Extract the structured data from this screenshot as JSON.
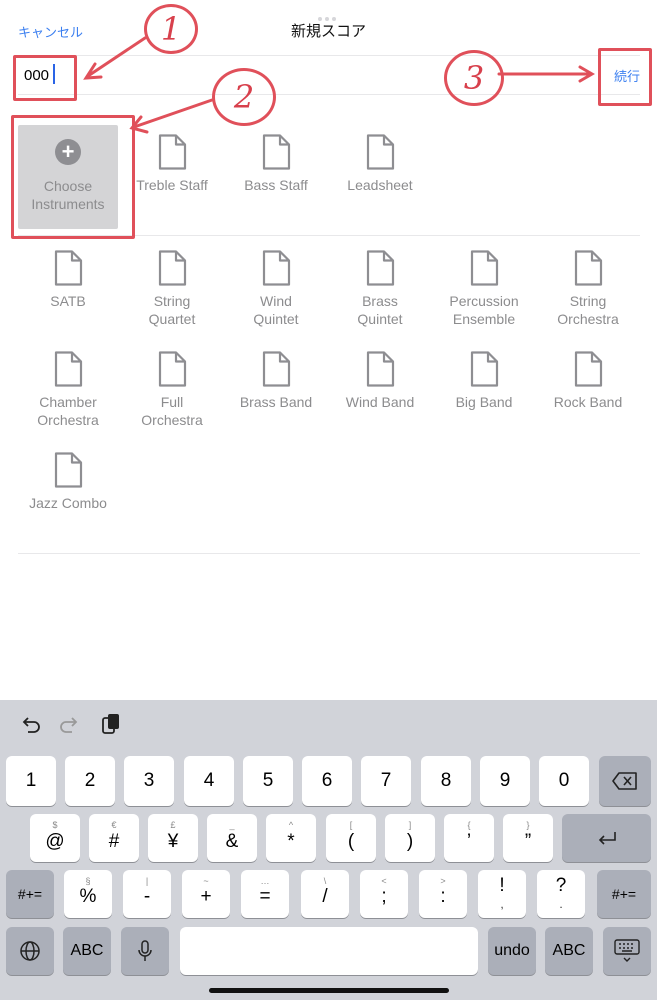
{
  "header": {
    "cancel_label": "キャンセル",
    "title": "新規スコア",
    "continue_label": "続行",
    "name_value": "000"
  },
  "annotations": [
    "1",
    "2",
    "3"
  ],
  "annotation_color": "#e0505a",
  "accent_color": "#3b7ff0",
  "choose": {
    "label_line1": "Choose",
    "label_line2": "Instruments",
    "icon": "plus-circle-icon"
  },
  "templates_row1": [
    {
      "l1": "Treble Staff",
      "l2": ""
    },
    {
      "l1": "Bass Staff",
      "l2": ""
    },
    {
      "l1": "Leadsheet",
      "l2": ""
    }
  ],
  "templates": [
    {
      "l1": "SATB",
      "l2": ""
    },
    {
      "l1": "String",
      "l2": "Quartet"
    },
    {
      "l1": "Wind",
      "l2": "Quintet"
    },
    {
      "l1": "Brass",
      "l2": "Quintet"
    },
    {
      "l1": "Percussion",
      "l2": "Ensemble"
    },
    {
      "l1": "String",
      "l2": "Orchestra"
    },
    {
      "l1": "Chamber",
      "l2": "Orchestra"
    },
    {
      "l1": "Full",
      "l2": "Orchestra"
    },
    {
      "l1": "Brass Band",
      "l2": ""
    },
    {
      "l1": "Wind Band",
      "l2": ""
    },
    {
      "l1": "Big Band",
      "l2": ""
    },
    {
      "l1": "Rock Band",
      "l2": ""
    },
    {
      "l1": "Jazz Combo",
      "l2": ""
    }
  ],
  "keyboard": {
    "toolbar": [
      "undo-icon",
      "redo-icon",
      "paste-icon"
    ],
    "row1": [
      "1",
      "2",
      "3",
      "4",
      "5",
      "6",
      "7",
      "8",
      "9",
      "0"
    ],
    "row2": [
      {
        "s": "$",
        "b": "@"
      },
      {
        "s": "€",
        "b": "#"
      },
      {
        "s": "£",
        "b": "¥"
      },
      {
        "s": "_",
        "b": "&"
      },
      {
        "s": "^",
        "b": "*"
      },
      {
        "s": "[",
        "b": "("
      },
      {
        "s": "]",
        "b": ")"
      },
      {
        "s": "{",
        "b": "’"
      },
      {
        "s": "}",
        "b": "”"
      }
    ],
    "row3": [
      {
        "s": "§",
        "b": "%"
      },
      {
        "s": "|",
        "b": "-"
      },
      {
        "s": "~",
        "b": "+"
      },
      {
        "s": "…",
        "b": "="
      },
      {
        "s": "\\",
        "b": "/"
      },
      {
        "s": "<",
        "b": ";"
      },
      {
        "s": ">",
        "b": ":"
      },
      {
        "s": "!",
        "b": "!"
      },
      {
        "s": "?",
        "b": "?"
      }
    ],
    "row3_sub": [
      ",",
      "."
    ],
    "sym_label": "#+=",
    "abc_label": "ABC",
    "undo_label": "undo"
  }
}
